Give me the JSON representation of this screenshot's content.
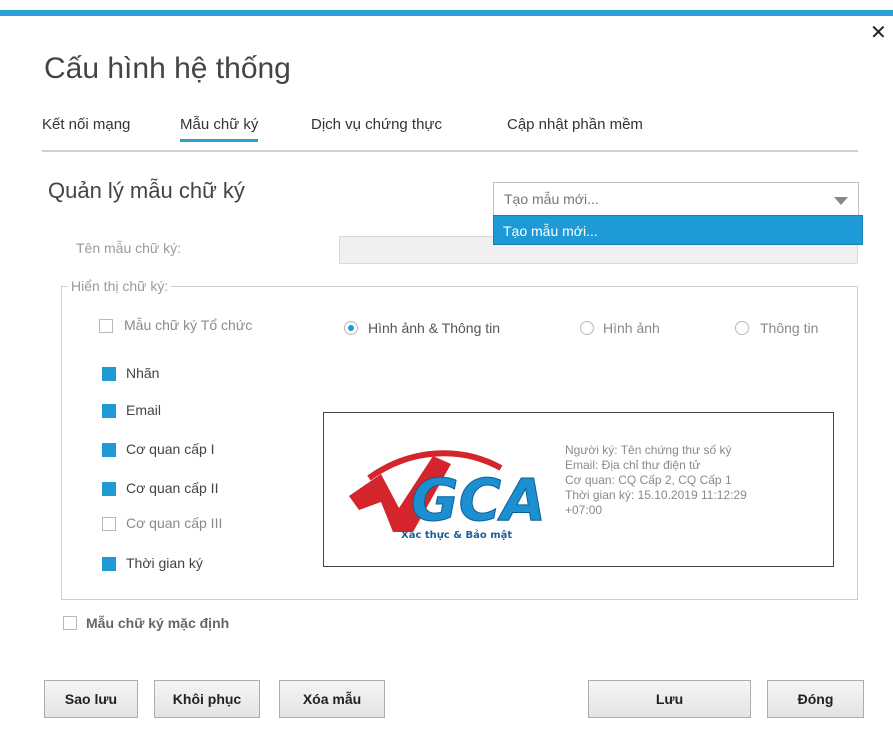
{
  "colors": {
    "accent": "#2aa0d6",
    "checkbox_checked": "#1e9ad6",
    "dropdown_highlight": "#1e9ad6"
  },
  "window": {
    "top_text_fragment": "...",
    "close_icon": "✕",
    "title": "Cấu hình hệ thống"
  },
  "tabs": [
    {
      "label": "Kết nối mạng",
      "active": false
    },
    {
      "label": "Mẫu chữ ký",
      "active": true
    },
    {
      "label": "Dịch vụ chứng thực",
      "active": false
    },
    {
      "label": "Cập nhật phần mềm",
      "active": false
    }
  ],
  "manage": {
    "title": "Quản lý mẫu chữ ký",
    "template_select_value": "Tạo mẫu mới...",
    "dropdown_options": [
      "Tạo mẫu mới..."
    ]
  },
  "form": {
    "name_label": "Tên mẫu chữ ký:",
    "name_value": "",
    "display_group_label": "Hiển thị chữ ký:",
    "org_template": {
      "label": "Mẫu chữ ký Tổ chức",
      "checked": false
    },
    "radios": [
      {
        "label": "Hình ảnh & Thông tin",
        "selected": true
      },
      {
        "label": "Hình ảnh",
        "selected": false
      },
      {
        "label": "Thông tin",
        "selected": false
      }
    ],
    "checkboxes": [
      {
        "label": "Nhãn",
        "checked": true
      },
      {
        "label": "Email",
        "checked": true
      },
      {
        "label": "Cơ quan cấp I",
        "checked": true
      },
      {
        "label": "Cơ quan cấp II",
        "checked": true
      },
      {
        "label": "Cơ quan cấp III",
        "checked": false
      },
      {
        "label": "Thời gian ký",
        "checked": true
      }
    ],
    "default_template": {
      "label": "Mẫu chữ ký mặc định",
      "checked": false
    }
  },
  "preview": {
    "logo_text": "GCA",
    "logo_tagline": "Xác thực & Bảo mật",
    "lines": [
      "Người ký: Tên chứng thư số ký",
      "Email: Địa chỉ thư điện tử",
      "Cơ quan: CQ Cấp 2, CQ Cấp 1",
      "Thời gian ký: 15.10.2019 11:12:29",
      "+07:00"
    ]
  },
  "buttons": {
    "backup": "Sao lưu",
    "restore": "Khôi phục",
    "delete": "Xóa mẫu",
    "save": "Lưu",
    "close": "Đóng"
  }
}
